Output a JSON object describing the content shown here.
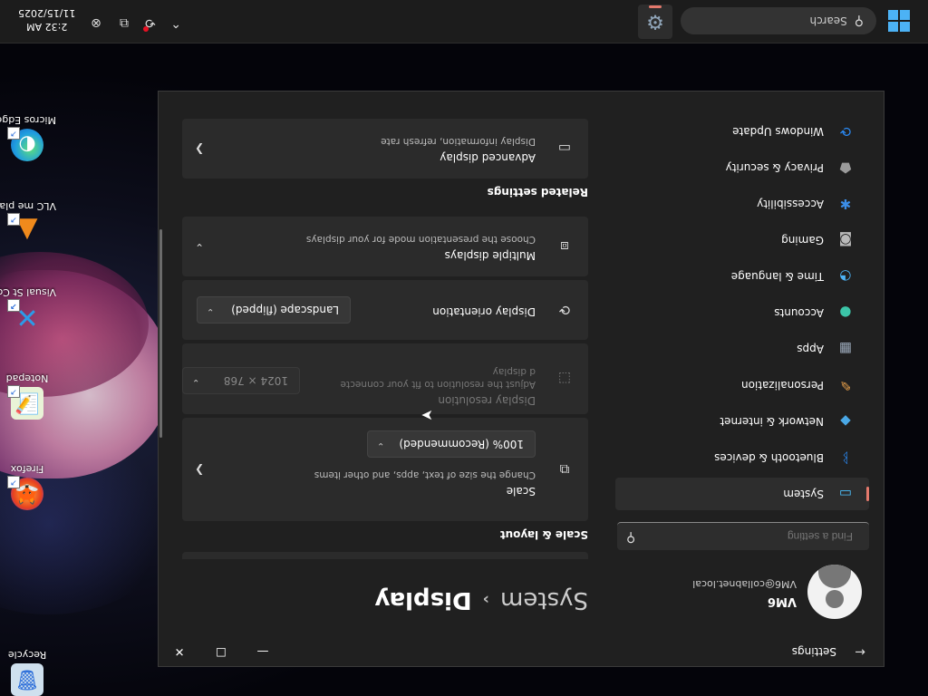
{
  "desktop": {
    "icons": [
      {
        "name": "recycle-bin",
        "label": "Recycle",
        "glyph": "🗑"
      },
      {
        "name": "firefox",
        "label": "Firefox",
        "glyph": "🦊"
      },
      {
        "name": "notepad-plus-plus",
        "label": "Notepad",
        "glyph": "📝"
      },
      {
        "name": "visual-studio-code",
        "label": "Visual St Code",
        "glyph": "✕"
      },
      {
        "name": "vlc-media-player",
        "label": "VLC me playe",
        "glyph": "▲"
      },
      {
        "name": "microsoft-edge",
        "label": "Micros Edge",
        "glyph": "◐"
      }
    ]
  },
  "window": {
    "app_title": "Settings",
    "back_icon": "←",
    "min_icon": "—",
    "max_icon": "☐",
    "close_icon": "✕"
  },
  "user": {
    "name": "VM6",
    "email": "VM6@collabnet.local"
  },
  "find": {
    "placeholder": "Find a setting",
    "icon": "⚲"
  },
  "nav": [
    {
      "label": "System",
      "icon": "▭",
      "icon_color": "#4cc2ff",
      "active": true
    },
    {
      "label": "Bluetooth & devices",
      "icon": "ᛒ",
      "icon_color": "#2a8af5",
      "active": false
    },
    {
      "label": "Network & internet",
      "icon": "◆",
      "icon_color": "#4aa8e6",
      "active": false
    },
    {
      "label": "Personalization",
      "icon": "✎",
      "icon_color": "#e8a04a",
      "active": false
    },
    {
      "label": "Apps",
      "icon": "▦",
      "icon_color": "#9aa7b8",
      "active": false
    },
    {
      "label": "Accounts",
      "icon": "●",
      "icon_color": "#3cc5a8",
      "active": false
    },
    {
      "label": "Time & language",
      "icon": "◔",
      "icon_color": "#4cb2f5",
      "active": false
    },
    {
      "label": "Gaming",
      "icon": "◙",
      "icon_color": "#b8b8b8",
      "active": false
    },
    {
      "label": "Accessibility",
      "icon": "✱",
      "icon_color": "#3b8ee8",
      "active": false
    },
    {
      "label": "Privacy & security",
      "icon": "⬟",
      "icon_color": "#9a9a9a",
      "active": false
    },
    {
      "label": "Windows Update",
      "icon": "⟳",
      "icon_color": "#2a8af5",
      "active": false
    }
  ],
  "page": {
    "breadcrumb_parent": "System",
    "breadcrumb_sep": "›",
    "breadcrumb_current": "Display"
  },
  "scale_layout": {
    "heading": "Scale & layout",
    "scale": {
      "title": "Scale",
      "desc": "Change the size of text, apps, and other items",
      "value": "100% (Recommended)"
    },
    "resolution": {
      "title": "Display resolution",
      "desc_line1": "Adjust the resolution to fit your connecte",
      "desc_line2": "d display",
      "value": "1024 × 768"
    },
    "orientation": {
      "title": "Display orientation",
      "value": "Landscape (flipped)"
    },
    "multiple": {
      "title": "Multiple displays",
      "desc": "Choose the presentation mode for your displays"
    }
  },
  "related": {
    "heading": "Related settings",
    "advanced": {
      "title": "Advanced display",
      "desc": "Display information, refresh rate"
    }
  },
  "taskbar": {
    "search_label": "Search",
    "time": "2:32 AM",
    "date": "11/15/2025"
  },
  "colors": {
    "accent": "#e4796c",
    "window_bg": "#202020",
    "card_bg": "#2b2b2b"
  }
}
